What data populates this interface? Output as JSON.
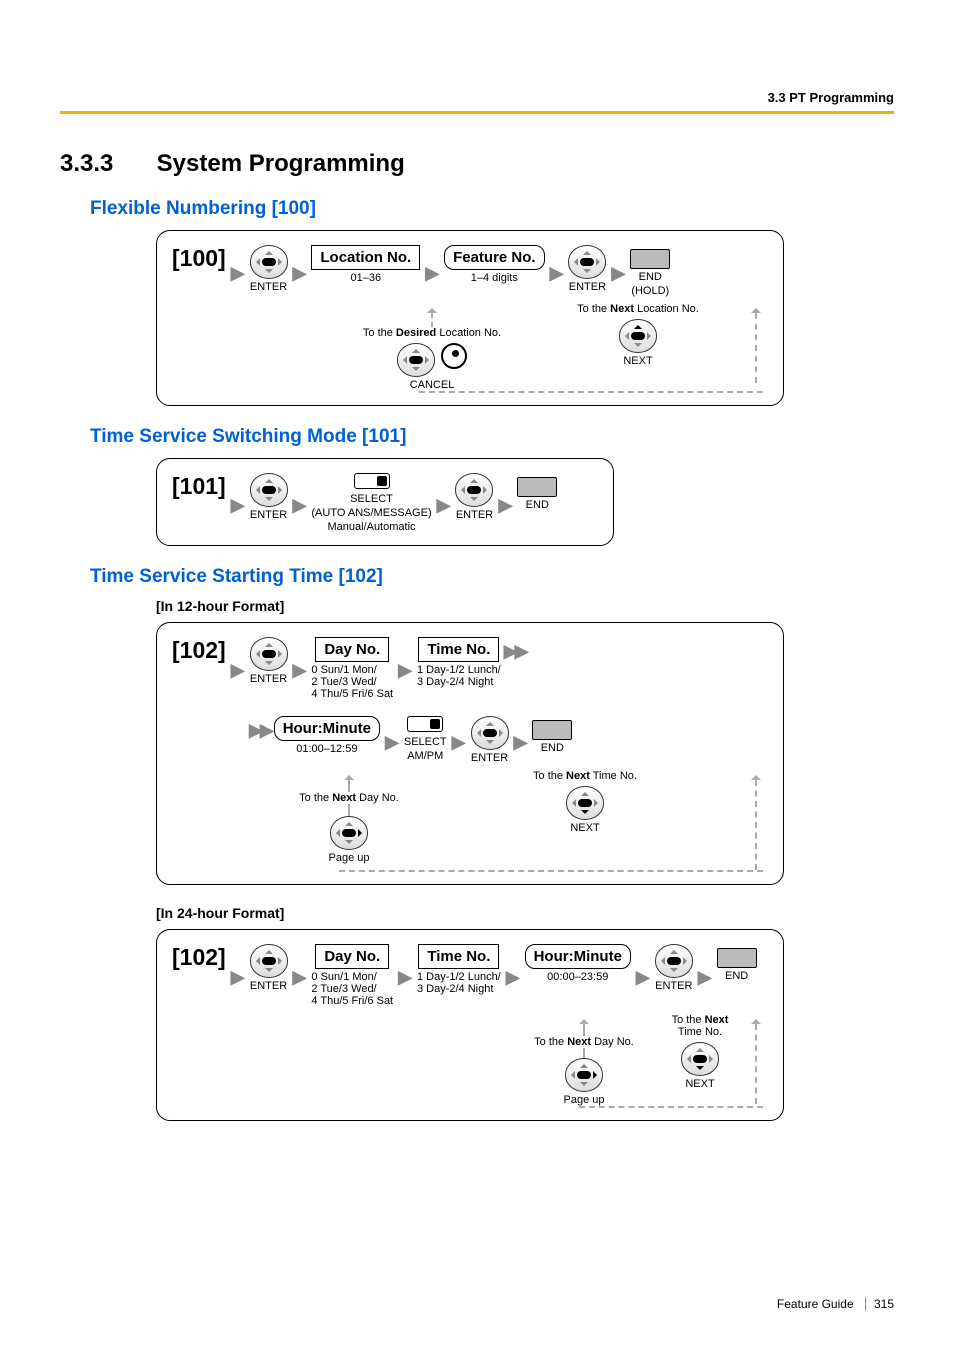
{
  "header": {
    "breadcrumb": "3.3 PT Programming"
  },
  "section": {
    "number": "3.3.3",
    "title": "System Programming"
  },
  "prog100": {
    "title": "Flexible Numbering [100]",
    "code": "[100]",
    "enter": "ENTER",
    "location_box": "Location No.",
    "location_range": "01–36",
    "feature_box": "Feature No.",
    "feature_range": "1–4 digits",
    "end": "END",
    "hold": "(HOLD)",
    "to_desired_location": "To the Desired Location No.",
    "to_next_location": "To the Next Location No.",
    "cancel": "CANCEL",
    "next": "NEXT"
  },
  "prog101": {
    "title": "Time Service Switching Mode [101]",
    "code": "[101]",
    "enter": "ENTER",
    "select": "SELECT",
    "select_sub": "(AUTO ANS/MESSAGE)",
    "options": "Manual/Automatic",
    "end": "END"
  },
  "prog102": {
    "title": "Time Service Starting Time [102]",
    "format12": "[In 12-hour Format]",
    "format24": "[In 24-hour Format]",
    "code": "[102]",
    "enter": "ENTER",
    "day_box": "Day No.",
    "day_opts": "0 Sun/1 Mon/\n2 Tue/3 Wed/\n4 Thu/5 Fri/6 Sat",
    "time_box": "Time No.",
    "time_opts": "1 Day-1/2 Lunch/\n3 Day-2/4 Night",
    "hour_box": "Hour:Minute",
    "hour_range12": "01:00–12:59",
    "hour_range24": "00:00–23:59",
    "select": "SELECT",
    "ampm": "AM/PM",
    "end": "END",
    "to_next_time": "To the Next Time No.",
    "to_next_day": "To the Next Day No.",
    "pageup": "Page up",
    "next": "NEXT"
  },
  "footer": {
    "guide": "Feature Guide",
    "page": "315"
  }
}
